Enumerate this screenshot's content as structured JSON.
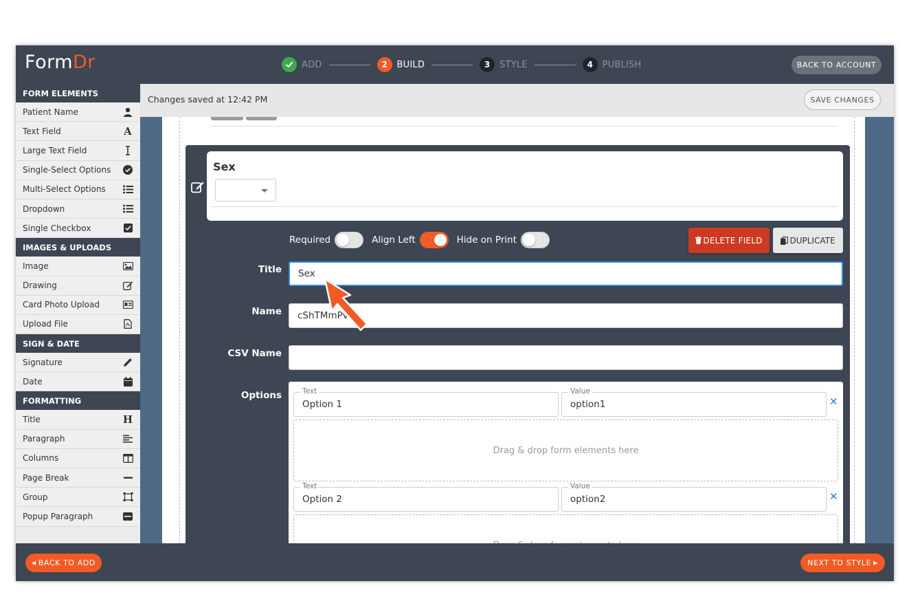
{
  "app": {
    "logo_part1": "Form",
    "logo_part2": "Dr"
  },
  "steps": [
    {
      "number": "✓",
      "label": "ADD",
      "state": "done"
    },
    {
      "number": "2",
      "label": "BUILD",
      "state": "active"
    },
    {
      "number": "3",
      "label": "STYLE",
      "state": "pending"
    },
    {
      "number": "4",
      "label": "PUBLISH",
      "state": "pending"
    }
  ],
  "header": {
    "back_to_account": "BACK TO ACCOUNT"
  },
  "savebar": {
    "status": "Changes saved at 12:42 PM",
    "save_changes": "SAVE CHANGES"
  },
  "sidebar": {
    "sections": [
      {
        "title": "FORM ELEMENTS",
        "items": [
          {
            "label": "Patient Name",
            "icon": "person-icon"
          },
          {
            "label": "Text Field",
            "icon": "letter-a-icon"
          },
          {
            "label": "Large Text Field",
            "icon": "text-cursor-icon"
          },
          {
            "label": "Single-Select Options",
            "icon": "check-circle-icon"
          },
          {
            "label": "Multi-Select Options",
            "icon": "list-icon"
          },
          {
            "label": "Dropdown",
            "icon": "list-icon"
          },
          {
            "label": "Single Checkbox",
            "icon": "checkbox-icon"
          }
        ]
      },
      {
        "title": "IMAGES & UPLOADS",
        "items": [
          {
            "label": "Image",
            "icon": "image-icon"
          },
          {
            "label": "Drawing",
            "icon": "edit-icon"
          },
          {
            "label": "Card Photo Upload",
            "icon": "id-card-icon"
          },
          {
            "label": "Upload File",
            "icon": "pdf-file-icon"
          }
        ]
      },
      {
        "title": "SIGN & DATE",
        "items": [
          {
            "label": "Signature",
            "icon": "pencil-icon"
          },
          {
            "label": "Date",
            "icon": "calendar-icon"
          }
        ]
      },
      {
        "title": "FORMATTING",
        "items": [
          {
            "label": "Title",
            "icon": "heading-icon"
          },
          {
            "label": "Paragraph",
            "icon": "align-left-icon"
          },
          {
            "label": "Columns",
            "icon": "columns-icon"
          },
          {
            "label": "Page Break",
            "icon": "minus-icon"
          },
          {
            "label": "Group",
            "icon": "group-icon"
          },
          {
            "label": "Popup Paragraph",
            "icon": "popup-icon"
          }
        ]
      }
    ]
  },
  "editor": {
    "preview_title": "Sex",
    "toggles": [
      {
        "label": "Required",
        "on": false
      },
      {
        "label": "Align Left",
        "on": true
      },
      {
        "label": "Hide on Print",
        "on": false
      }
    ],
    "delete_label": "DELETE FIELD",
    "duplicate_label": "DUPLICATE",
    "title_label": "Title",
    "title_value": "Sex",
    "name_label": "Name",
    "name_value": "cShTMmPv",
    "csv_label": "CSV Name",
    "csv_value": "",
    "options_label": "Options",
    "options": [
      {
        "text_caption": "Text",
        "text": "Option 1",
        "value_caption": "Value",
        "value": "option1"
      },
      {
        "text_caption": "Text",
        "text": "Option 2",
        "value_caption": "Value",
        "value": "option2"
      }
    ],
    "drop_zone_text": "Drag & drop form elements here"
  },
  "footer": {
    "back_to_add": "BACK TO ADD",
    "next_to_style": "NEXT TO STYLE"
  },
  "colors": {
    "brand": "#f25a26",
    "dark": "#3d4652",
    "success": "#3eaa4f",
    "delete": "#cc3a22",
    "focus": "#2d8fe0"
  }
}
